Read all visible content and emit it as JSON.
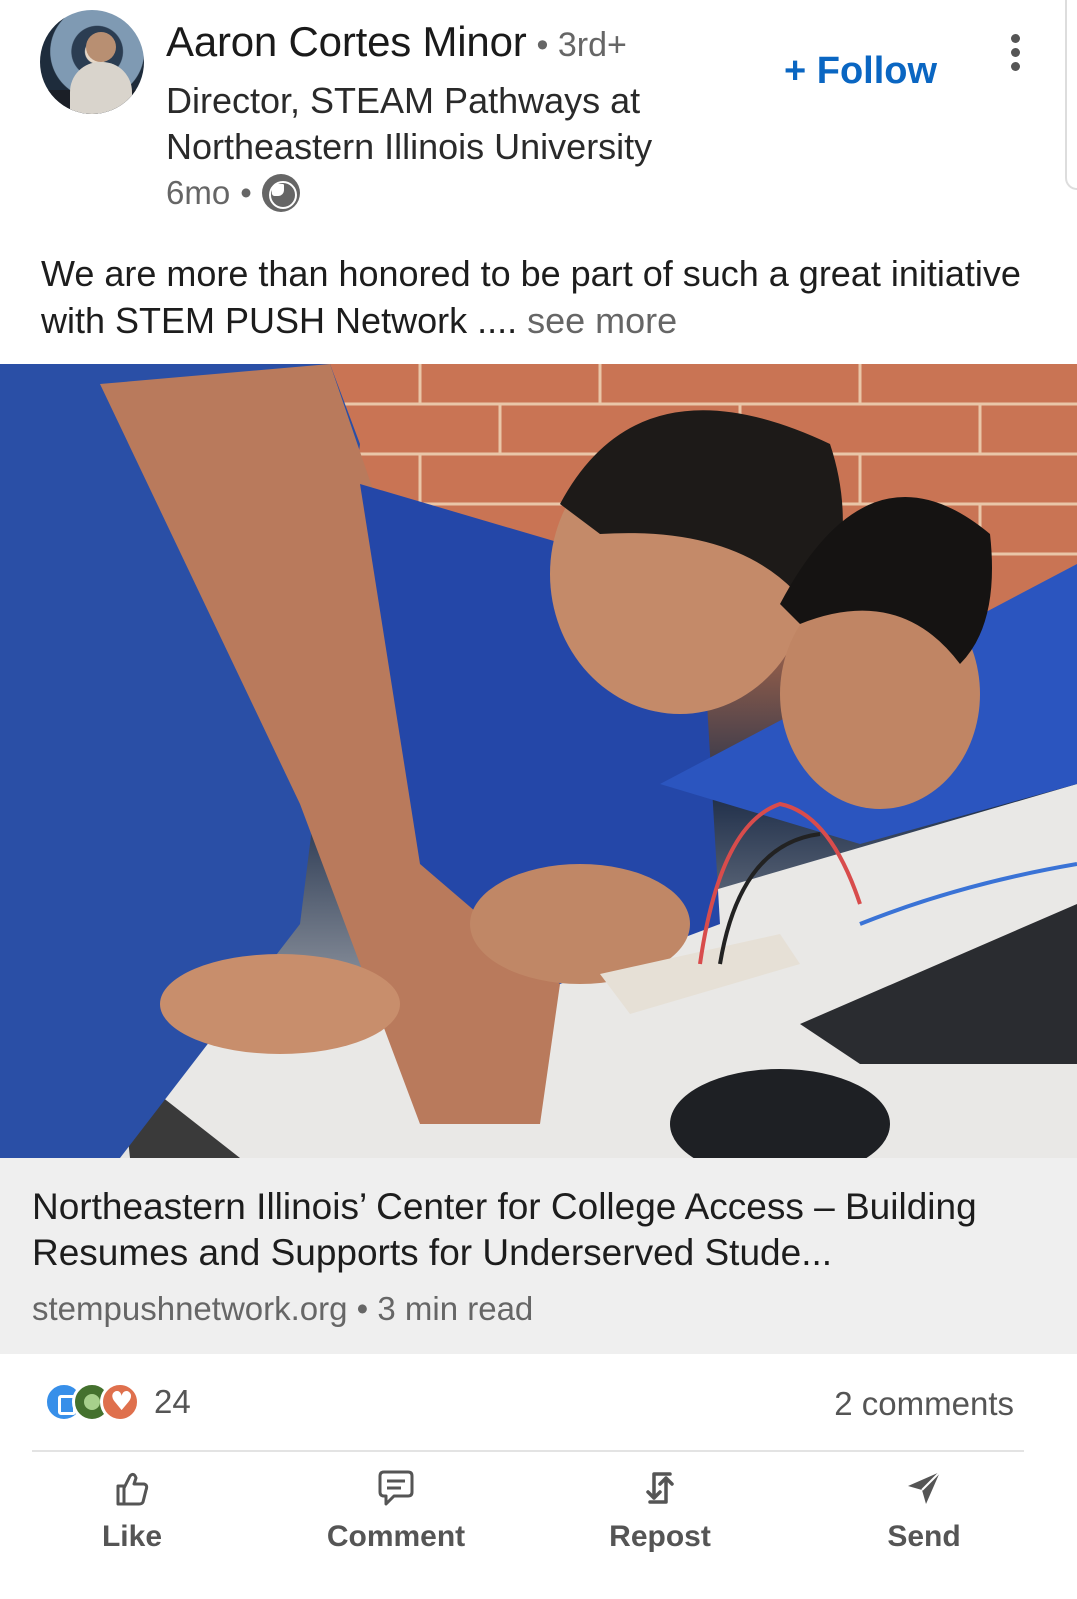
{
  "author": {
    "name": "Aaron Cortes Minor",
    "degree": "• 3rd+",
    "headline": "Director, STEAM Pathways at Northeastern Illinois University",
    "age": "6mo",
    "visibility_icon": "globe-icon"
  },
  "header": {
    "follow_label": "+ Follow",
    "more_icon": "more-vertical-icon"
  },
  "post": {
    "text": "We are more than honored to be part of such a great initiative with STEM PUSH Network ....",
    "see_more": "see more"
  },
  "link_card": {
    "title": "Northeastern Illinois’ Center for College Access – Building Resumes and Supports for Underserved Stude...",
    "source": "stempushnetwork.org • 3 min read"
  },
  "social": {
    "reactions": [
      "like",
      "celebrate",
      "love"
    ],
    "reaction_count": "24",
    "comments": "2 comments"
  },
  "actions": [
    {
      "label": "Like",
      "icon": "like-icon"
    },
    {
      "label": "Comment",
      "icon": "comment-icon"
    },
    {
      "label": "Repost",
      "icon": "repost-icon"
    },
    {
      "label": "Send",
      "icon": "send-icon"
    }
  ],
  "colors": {
    "accent": "#0a66c2",
    "muted_text": "#666666",
    "card_bg": "#efefef"
  }
}
